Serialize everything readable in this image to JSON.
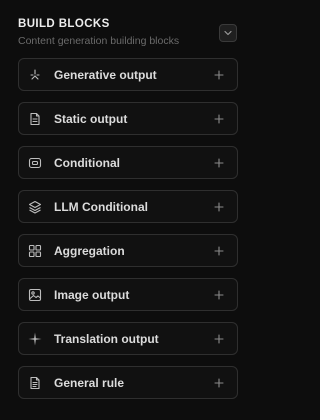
{
  "panel": {
    "title": "BUILD BLOCKS",
    "subtitle": "Content generation building blocks"
  },
  "blocks": [
    {
      "label": "Generative output",
      "icon": "sparkle-icon"
    },
    {
      "label": "Static output",
      "icon": "document-icon"
    },
    {
      "label": "Conditional",
      "icon": "toggle-box-icon"
    },
    {
      "label": "LLM Conditional",
      "icon": "layers-icon"
    },
    {
      "label": "Aggregation",
      "icon": "grid-icon"
    },
    {
      "label": "Image output",
      "icon": "image-icon"
    },
    {
      "label": "Translation output",
      "icon": "star-burst-icon"
    },
    {
      "label": "General rule",
      "icon": "file-lines-icon"
    }
  ]
}
